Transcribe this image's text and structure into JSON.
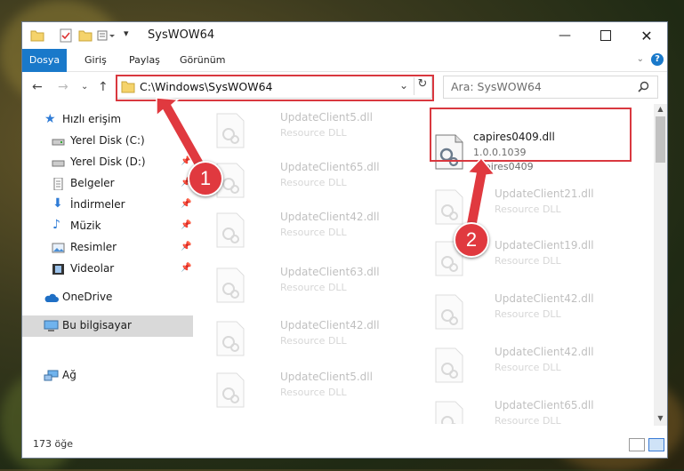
{
  "window": {
    "title": "SysWOW64"
  },
  "ribbon": {
    "tabs": [
      "Dosya",
      "Giriş",
      "Paylaş",
      "Görünüm"
    ],
    "help": "?"
  },
  "address": {
    "path": "C:\\Windows\\SysWOW64"
  },
  "search": {
    "placeholder": "Ara: SysWOW64"
  },
  "sidebar": {
    "items": [
      {
        "label": "Hızlı erişim",
        "icon": "star-icon",
        "pinned": false
      },
      {
        "label": "Yerel Disk (C:)",
        "icon": "drive-icon",
        "pinned": false
      },
      {
        "label": "Yerel Disk (D:)",
        "icon": "drive-icon",
        "pinned": true
      },
      {
        "label": "Belgeler",
        "icon": "document-icon",
        "pinned": true
      },
      {
        "label": "İndirmeler",
        "icon": "download-icon",
        "pinned": true
      },
      {
        "label": "Müzik",
        "icon": "music-icon",
        "pinned": true
      },
      {
        "label": "Resimler",
        "icon": "picture-icon",
        "pinned": true
      },
      {
        "label": "Videolar",
        "icon": "video-icon",
        "pinned": true
      },
      {
        "label": "OneDrive",
        "icon": "cloud-icon",
        "pinned": false
      },
      {
        "label": "Bu bilgisayar",
        "icon": "computer-icon",
        "pinned": false,
        "selected": true
      },
      {
        "label": "Ağ",
        "icon": "network-icon",
        "pinned": false
      }
    ]
  },
  "files": {
    "left": [
      {
        "name": "UpdateClient5.dll",
        "desc": "Resource DLL"
      },
      {
        "name": "UpdateClient65.dll",
        "desc": "Resource DLL"
      },
      {
        "name": "UpdateClient42.dll",
        "desc": "Resource DLL"
      },
      {
        "name": "UpdateClient63.dll",
        "desc": "Resource DLL"
      },
      {
        "name": "UpdateClient42.dll",
        "desc": "Resource DLL"
      },
      {
        "name": "UpdateClient5.dll",
        "desc": "Resource DLL"
      }
    ],
    "highlight": {
      "name": "capires0409.dll",
      "version": "1.0.0.1039",
      "desc": "capires0409"
    },
    "right": [
      {
        "name": "UpdateClient21.dll",
        "desc": "Resource DLL"
      },
      {
        "name": "UpdateClient19.dll",
        "desc": "Resource DLL"
      },
      {
        "name": "UpdateClient42.dll",
        "desc": "Resource DLL"
      },
      {
        "name": "UpdateClient42.dll",
        "desc": "Resource DLL"
      },
      {
        "name": "UpdateClient65.dll",
        "desc": "Resource DLL"
      }
    ]
  },
  "status": {
    "count": "173 öğe"
  },
  "annotations": {
    "step1": "1",
    "step2": "2",
    "color": "#e0393f"
  }
}
